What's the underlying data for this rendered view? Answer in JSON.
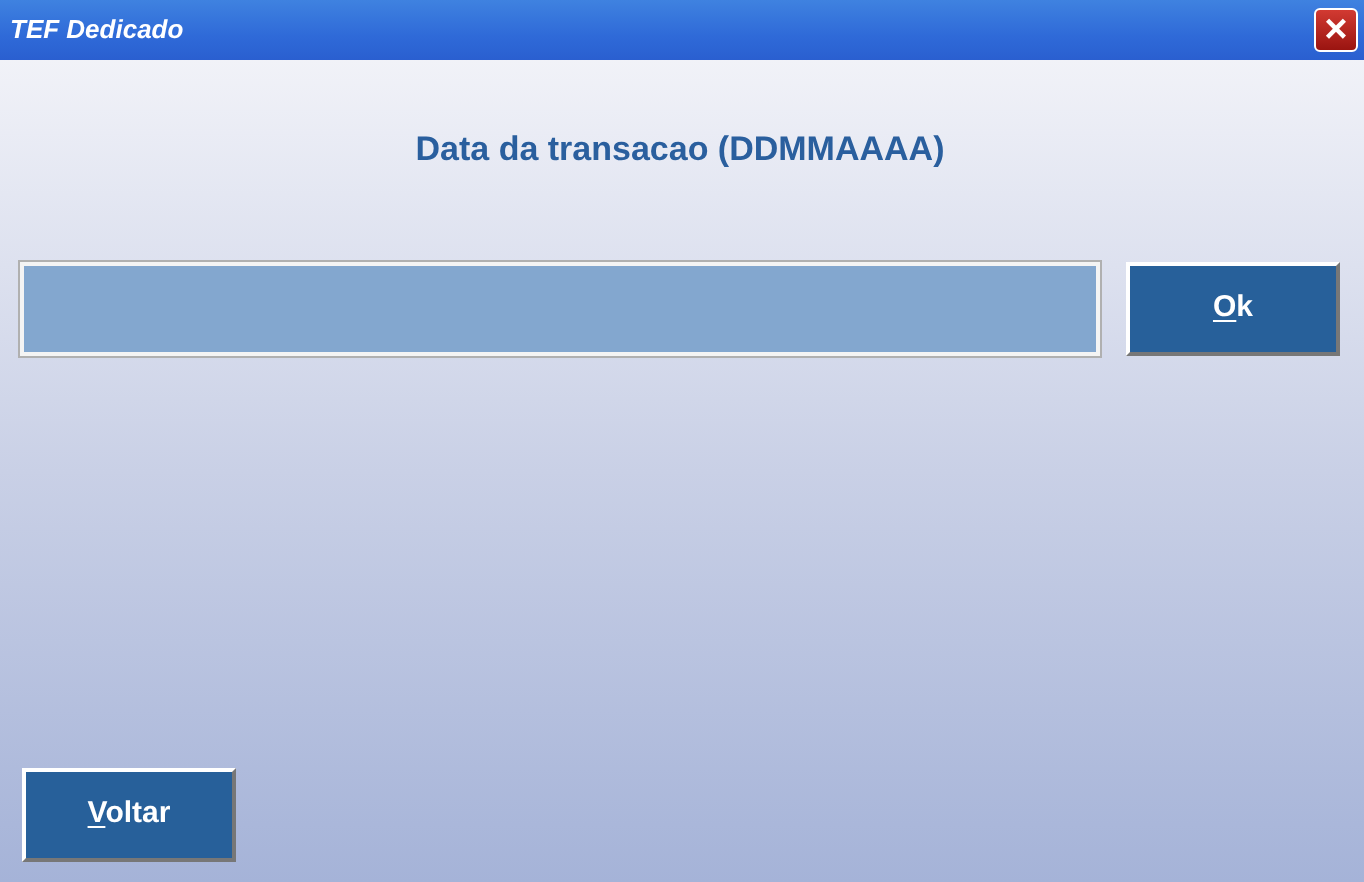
{
  "window": {
    "title": "TEF Dedicado",
    "close": "×"
  },
  "prompt": "Data da transacao (DDMMAAAA)",
  "ok_button": {
    "mnemonic": "O",
    "rest": "k"
  },
  "back_button": {
    "mnemonic": "V",
    "rest": "oltar"
  }
}
